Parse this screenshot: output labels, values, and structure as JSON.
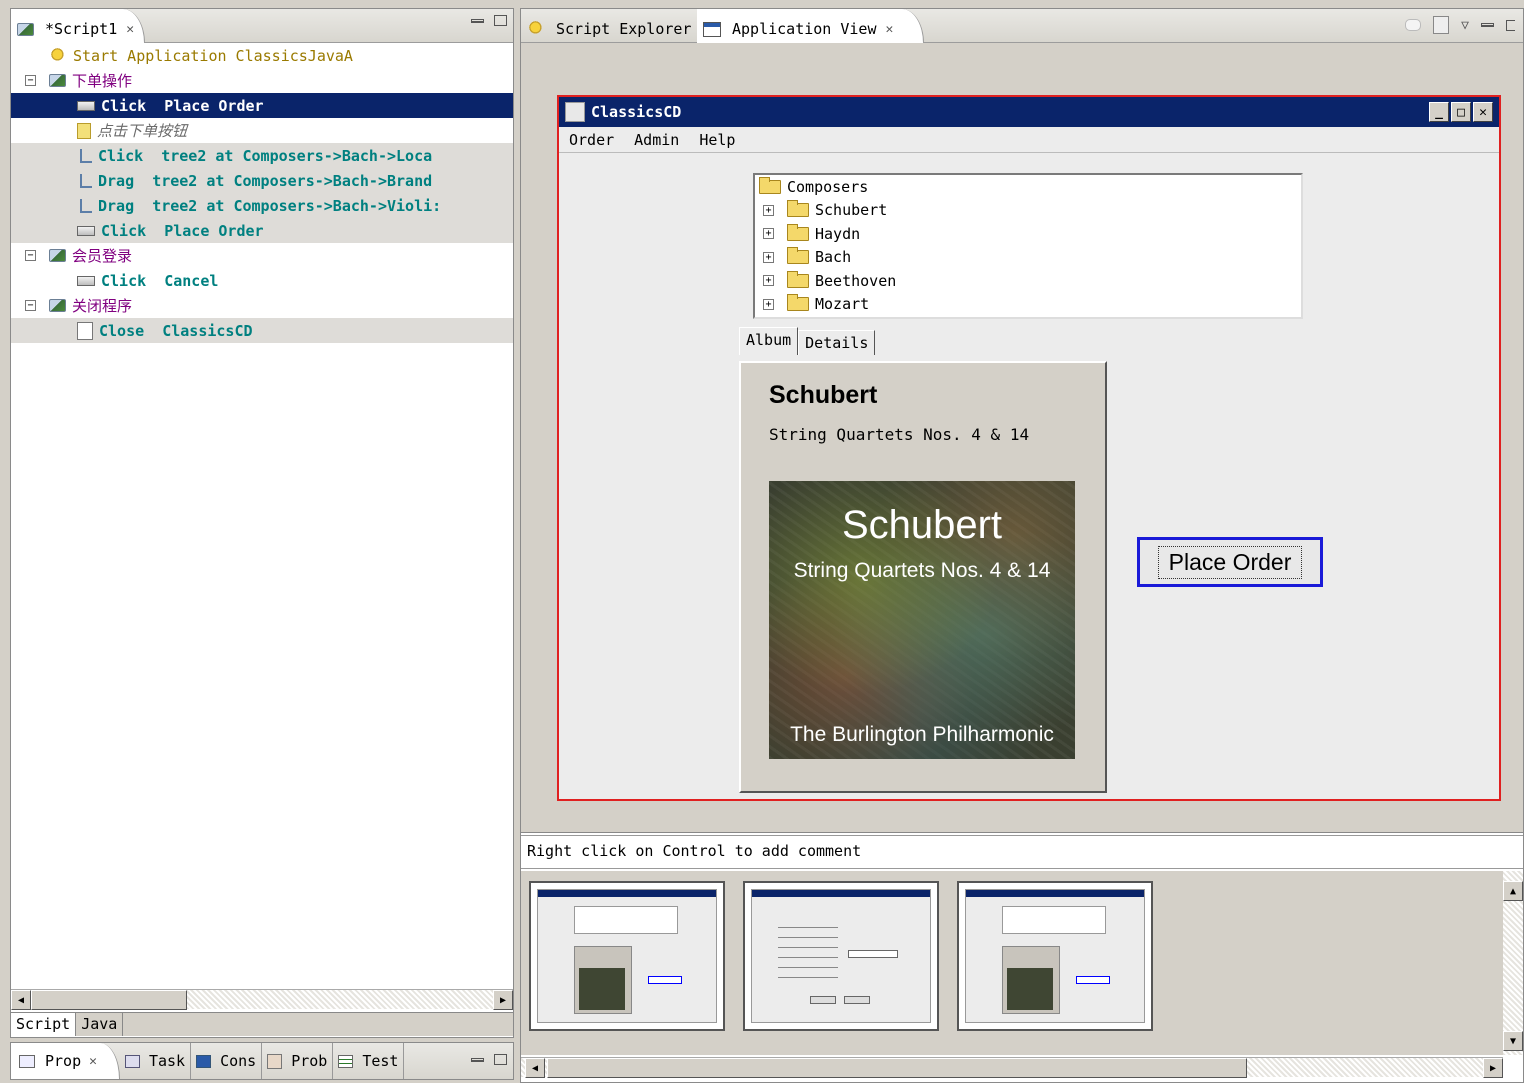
{
  "left_panel": {
    "tab_title": "*Script1",
    "rows": [
      {
        "kind": "start",
        "text": "Start  Application  ClassicsJavaA"
      },
      {
        "kind": "group",
        "label": "下单操作"
      },
      {
        "kind": "action",
        "verb": "Click",
        "args": "Place Order",
        "selected": true
      },
      {
        "kind": "comment",
        "text": "点击下单按钮"
      },
      {
        "kind": "tree",
        "verb": "Click",
        "args": "tree2  at  Composers->Bach->Loca"
      },
      {
        "kind": "tree",
        "verb": "Drag",
        "args": "tree2  at  Composers->Bach->Brand"
      },
      {
        "kind": "tree",
        "verb": "Drag",
        "args": "tree2  at  Composers->Bach->Violi:"
      },
      {
        "kind": "action",
        "verb": "Click",
        "args": "Place Order"
      },
      {
        "kind": "group",
        "label": "会员登录"
      },
      {
        "kind": "action",
        "verb": "Click",
        "args": "Cancel"
      },
      {
        "kind": "group",
        "label": "关闭程序"
      },
      {
        "kind": "close",
        "verb": "Close",
        "args": "ClassicsCD"
      }
    ],
    "bottom_tabs": [
      "Script",
      "Java"
    ]
  },
  "views_bar": {
    "tabs": [
      "Prop",
      "Task",
      "Cons",
      "Prob",
      "Test"
    ]
  },
  "right_panel": {
    "tabs": [
      "Script Explorer",
      "Application View"
    ],
    "app": {
      "title": "ClassicsCD",
      "menu": [
        "Order",
        "Admin",
        "Help"
      ],
      "tree_root": "Composers",
      "composers": [
        "Schubert",
        "Haydn",
        "Bach",
        "Beethoven",
        "Mozart"
      ],
      "pane_tabs": [
        "Album",
        "Details"
      ],
      "album_title": "Schubert",
      "album_subtitle": "String Quartets Nos. 4 & 14",
      "cover_title": "Schubert",
      "cover_subtitle": "String Quartets Nos. 4 & 14",
      "cover_footer": "The Burlington Philharmonic",
      "place_order_label": "Place Order"
    },
    "status_hint": "Right click on Control to add comment"
  }
}
